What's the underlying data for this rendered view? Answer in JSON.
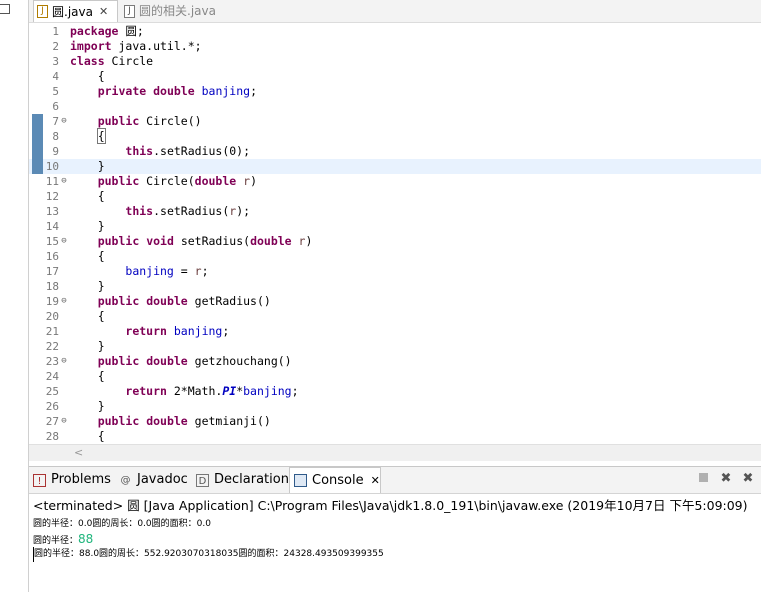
{
  "editor": {
    "tabs": [
      {
        "label": "圆.java",
        "active": true
      },
      {
        "label": "圆的相关.java",
        "active": false
      }
    ],
    "lines": [
      {
        "n": "1",
        "fold": "",
        "tokens": [
          [
            "kw",
            "package"
          ],
          [
            "t",
            " 圆;"
          ]
        ]
      },
      {
        "n": "2",
        "fold": "",
        "tokens": [
          [
            "kw",
            "import"
          ],
          [
            "t",
            " java.util.*;"
          ]
        ]
      },
      {
        "n": "3",
        "fold": "",
        "tokens": [
          [
            "kw",
            "class"
          ],
          [
            "t",
            " Circle"
          ]
        ]
      },
      {
        "n": "4",
        "fold": "",
        "tokens": [
          [
            "t",
            "    {"
          ]
        ]
      },
      {
        "n": "5",
        "fold": "",
        "tokens": [
          [
            "t",
            "    "
          ],
          [
            "kw",
            "private"
          ],
          [
            "t",
            " "
          ],
          [
            "kw",
            "double"
          ],
          [
            "t",
            " "
          ],
          [
            "fld",
            "banjing"
          ],
          [
            "t",
            ";"
          ]
        ]
      },
      {
        "n": "6",
        "fold": "",
        "tokens": [
          [
            "t",
            ""
          ]
        ]
      },
      {
        "n": "7",
        "fold": "⊖",
        "tokens": [
          [
            "t",
            "    "
          ],
          [
            "kw",
            "public"
          ],
          [
            "t",
            " Circle()"
          ]
        ]
      },
      {
        "n": "8",
        "fold": "",
        "tokens": [
          [
            "t",
            "    "
          ],
          [
            "box",
            "{"
          ]
        ]
      },
      {
        "n": "9",
        "fold": "",
        "tokens": [
          [
            "t",
            "        "
          ],
          [
            "kw",
            "this"
          ],
          [
            "t",
            ".setRadius(0);"
          ]
        ]
      },
      {
        "n": "10",
        "fold": "",
        "tokens": [
          [
            "t",
            "    }"
          ]
        ]
      },
      {
        "n": "11",
        "fold": "⊖",
        "tokens": [
          [
            "t",
            "    "
          ],
          [
            "kw",
            "public"
          ],
          [
            "t",
            " Circle("
          ],
          [
            "kw",
            "double"
          ],
          [
            "t",
            " "
          ],
          [
            "prm",
            "r"
          ],
          [
            "t",
            ")"
          ]
        ]
      },
      {
        "n": "12",
        "fold": "",
        "tokens": [
          [
            "t",
            "    {"
          ]
        ]
      },
      {
        "n": "13",
        "fold": "",
        "tokens": [
          [
            "t",
            "        "
          ],
          [
            "kw",
            "this"
          ],
          [
            "t",
            ".setRadius("
          ],
          [
            "prm",
            "r"
          ],
          [
            "t",
            ");"
          ]
        ]
      },
      {
        "n": "14",
        "fold": "",
        "tokens": [
          [
            "t",
            "    }"
          ]
        ]
      },
      {
        "n": "15",
        "fold": "⊖",
        "tokens": [
          [
            "t",
            "    "
          ],
          [
            "kw",
            "public"
          ],
          [
            "t",
            " "
          ],
          [
            "kw",
            "void"
          ],
          [
            "t",
            " setRadius("
          ],
          [
            "kw",
            "double"
          ],
          [
            "t",
            " "
          ],
          [
            "prm",
            "r"
          ],
          [
            "t",
            ")"
          ]
        ]
      },
      {
        "n": "16",
        "fold": "",
        "tokens": [
          [
            "t",
            "    {"
          ]
        ]
      },
      {
        "n": "17",
        "fold": "",
        "tokens": [
          [
            "t",
            "        "
          ],
          [
            "fld",
            "banjing"
          ],
          [
            "t",
            " = "
          ],
          [
            "prm",
            "r"
          ],
          [
            "t",
            ";"
          ]
        ]
      },
      {
        "n": "18",
        "fold": "",
        "tokens": [
          [
            "t",
            "    }"
          ]
        ]
      },
      {
        "n": "19",
        "fold": "⊖",
        "tokens": [
          [
            "t",
            "    "
          ],
          [
            "kw",
            "public"
          ],
          [
            "t",
            " "
          ],
          [
            "kw",
            "double"
          ],
          [
            "t",
            " getRadius()"
          ]
        ]
      },
      {
        "n": "20",
        "fold": "",
        "tokens": [
          [
            "t",
            "    {"
          ]
        ]
      },
      {
        "n": "21",
        "fold": "",
        "tokens": [
          [
            "t",
            "        "
          ],
          [
            "kw",
            "return"
          ],
          [
            "t",
            " "
          ],
          [
            "fld",
            "banjing"
          ],
          [
            "t",
            ";"
          ]
        ]
      },
      {
        "n": "22",
        "fold": "",
        "tokens": [
          [
            "t",
            "    }"
          ]
        ]
      },
      {
        "n": "23",
        "fold": "⊖",
        "tokens": [
          [
            "t",
            "    "
          ],
          [
            "kw",
            "public"
          ],
          [
            "t",
            " "
          ],
          [
            "kw",
            "double"
          ],
          [
            "t",
            " getzhouchang()"
          ]
        ]
      },
      {
        "n": "24",
        "fold": "",
        "tokens": [
          [
            "t",
            "    {"
          ]
        ]
      },
      {
        "n": "25",
        "fold": "",
        "tokens": [
          [
            "t",
            "        "
          ],
          [
            "kw",
            "return"
          ],
          [
            "t",
            " 2*Math."
          ],
          [
            "sfld",
            "PI"
          ],
          [
            "t",
            "*"
          ],
          [
            "fld",
            "banjing"
          ],
          [
            "t",
            ";"
          ]
        ]
      },
      {
        "n": "26",
        "fold": "",
        "tokens": [
          [
            "t",
            "    }"
          ]
        ]
      },
      {
        "n": "27",
        "fold": "⊖",
        "tokens": [
          [
            "t",
            "    "
          ],
          [
            "kw",
            "public"
          ],
          [
            "t",
            " "
          ],
          [
            "kw",
            "double"
          ],
          [
            "t",
            " getmianji()"
          ]
        ]
      },
      {
        "n": "28",
        "fold": "",
        "tokens": [
          [
            "t",
            "    {"
          ]
        ]
      }
    ],
    "highlighted_line": "10"
  },
  "panel": {
    "tabs": [
      {
        "label": "Problems",
        "icon": "problems-icon"
      },
      {
        "label": "Javadoc",
        "icon": "javadoc-icon"
      },
      {
        "label": "Declaration",
        "icon": "declaration-icon"
      },
      {
        "label": "Console",
        "icon": "console-icon"
      }
    ],
    "console_header": "<terminated> 圆 [Java Application] C:\\Program Files\\Java\\jdk1.8.0_191\\bin\\javaw.exe (2019年10月7日 下午5:09:09)",
    "output": [
      {
        "text": "圆的半径：0.0圆的周长：0.0圆的面积：0.0",
        "input": ""
      },
      {
        "text": "圆的半径：",
        "input": "88"
      },
      {
        "text": "圆的半径：88.0圆的周长：552.9203070318035圆的面积：24328.493509399355",
        "input": ""
      }
    ]
  },
  "colors": {
    "keyword": "#7f0055",
    "field": "#0000c0",
    "param": "#6a3e3e",
    "input": "#1fb57c"
  }
}
